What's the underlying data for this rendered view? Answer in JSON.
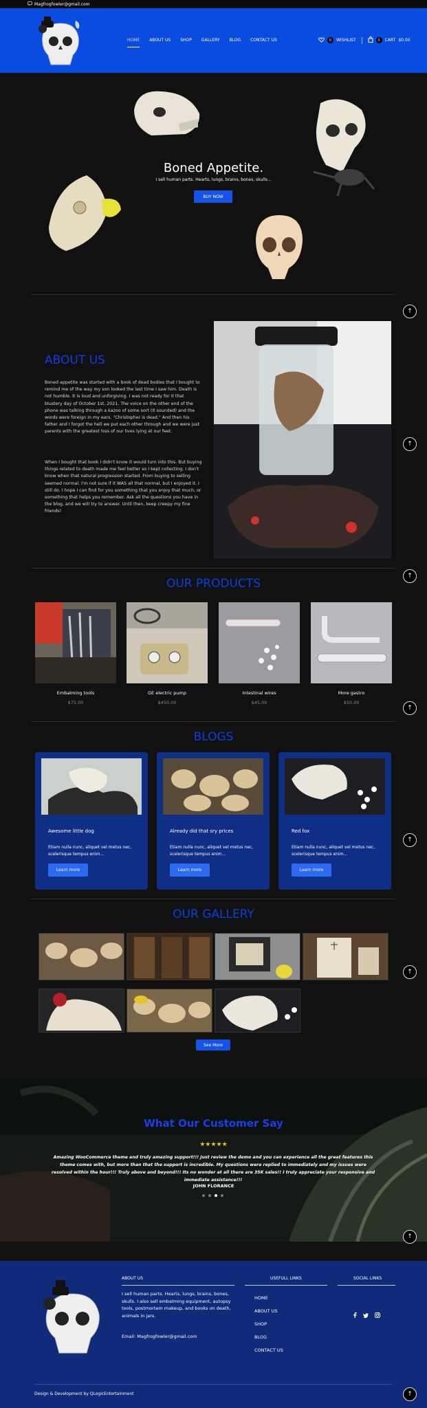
{
  "topbar": {
    "email": "Magfrogfowler@gmail.com"
  },
  "nav": {
    "items": [
      "HOME",
      "ABOUT US",
      "SHOP",
      "GALLERY",
      "BLOG",
      "CONTACT US"
    ]
  },
  "header": {
    "wishlist_count": "0",
    "wishlist_label": "WISHLIST",
    "cart_count": "0",
    "cart_label": "CART",
    "cart_total": "$0.00"
  },
  "hero": {
    "title": "Boned Appetite.",
    "subtitle": "I sell human parts. Hearts, lungs, brains, bones, skulls...",
    "button": "BUY NOW"
  },
  "about": {
    "title": "ABOUT US",
    "p1": "Boned appetite was started with a book of dead bodies that I bought to remind me of the way my son looked the last time I saw him. Death is not humble. It is loud and unforgiving. I was not ready for it that blustery day of October 1st, 2021. The voice on the other end of the phone was talking through a kazoo of some sort (it sounded) and the words were foreign in my ears. \"Christopher is dead.\" And then his father and I forgot the hell we put each other through and we were just parents with the greatest loss of our lives lying at our feet.",
    "p2": "When I bought that book I didn't know it would turn into this. But buying things related to death made me feel better so I kept collecting. I don't know when that natural progression started. From buying to selling seemed normal. I'm not sure if it WAS all that normal, but I enjoyed it. I still do. I hope I can find for you something that you enjoy that much, or something that helps you remember. Ask all the questions you have in the blog, and we will try to answer. Until then, keep creepy my fine friends!"
  },
  "products": {
    "title": "OUR PRODUCTS",
    "items": [
      {
        "name": "Embalming tools",
        "price": "$75.00"
      },
      {
        "name": "GE electric pump",
        "price": "$450.00"
      },
      {
        "name": "Intestinal wires",
        "price": "$45.00"
      },
      {
        "name": "More gastro",
        "price": "$50.00"
      }
    ]
  },
  "blogs": {
    "title": "BLOGS",
    "items": [
      {
        "title": "Awesome little dog",
        "text": "Etiam nulla nunc, aliquet vel metus nec, scelerisque tempus enim...",
        "button": "Learn more"
      },
      {
        "title": "Already did that sry prices",
        "text": "Etiam nulla nunc, aliquet vel metus nec, scelerisque tempus enim...",
        "button": "Learn more"
      },
      {
        "title": "Red fox",
        "text": "Etiam nulla nunc, aliquet vel metus nec, scelerisque tempus enim...",
        "button": "Learn more"
      }
    ]
  },
  "gallery": {
    "title": "OUR GALLERY",
    "button": "See More"
  },
  "testimonial": {
    "title": "What Our Customer Say",
    "stars": "★★★★★",
    "quote": "Amazing WooCommerce theme and truly amazing support!!! Just review the demo and you can experience all the great features this theme comes with, but more than that the support is incredible. My questions were replied to immediately and my issues were resolved within the hour!!! Truly above and beyond!!! Its no wonder at all there are 35K sales!! I truly appreciate your responsive and immediate assistance!!!",
    "author": "JOHN FLORANCE"
  },
  "footer": {
    "about_heading": "ABOUT US",
    "about_text": "I sell human parts. Hearts, lungs, brains, bones, skulls. I also sell embalming equipment, autopsy tools, postmortem makeup, and books on death, animals in jars.",
    "email": "Email: Magfrogfowler@gmail.com",
    "links_heading": "USEFULL LINKS",
    "links": [
      "HOME",
      "ABOUT US",
      "SHOP",
      "BLOG",
      "CONTACT US"
    ],
    "social_heading": "SOCIAL LINKS",
    "social_icons": [
      "facebook-icon",
      "twitter-icon",
      "instagram-icon"
    ],
    "credit": "Design & Development by QLogicEntertainment"
  },
  "colors": {
    "header_blue": "#0a4ce0",
    "title_blue": "#0b3fe0",
    "card_blue": "#0f2f86",
    "footer_blue": "#0f2b79",
    "star": "#f3c623"
  }
}
